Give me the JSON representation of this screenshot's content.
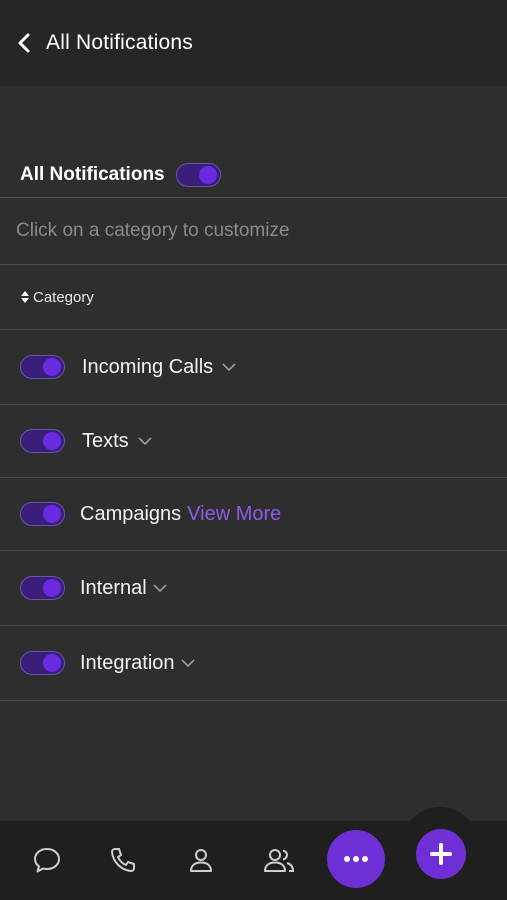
{
  "header": {
    "title": "All Notifications",
    "back_icon": "chevron-left-icon"
  },
  "master": {
    "label": "All Notifications",
    "enabled": true
  },
  "hint": "Click on a category to customize",
  "category_header": {
    "label": "Category",
    "sort_icon": "sort-icon"
  },
  "categories": [
    {
      "label": "Incoming Calls",
      "enabled": true,
      "expand_icon": "chevron-down-icon"
    },
    {
      "label": "Texts",
      "enabled": true,
      "expand_icon": "chevron-down-icon"
    },
    {
      "label": "Campaigns",
      "enabled": true,
      "link": "View More"
    },
    {
      "label": "Internal",
      "enabled": true,
      "expand_icon": "chevron-down-icon"
    },
    {
      "label": "Integration",
      "enabled": true,
      "expand_icon": "chevron-down-icon"
    }
  ],
  "bottom_nav": {
    "items": [
      "chat-icon",
      "phone-icon",
      "contact-icon",
      "team-icon",
      "more-icon",
      "add-icon"
    ]
  },
  "colors": {
    "accent": "#6e2fd6",
    "toggle_track": "#3a1f7a",
    "link": "#8e5ae6",
    "background": "#2e2e2e"
  }
}
